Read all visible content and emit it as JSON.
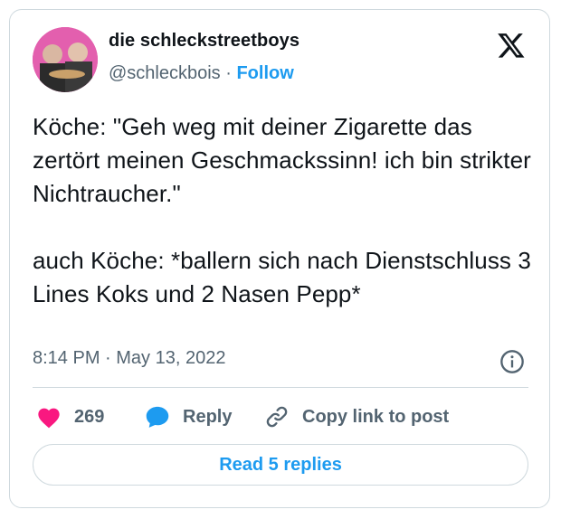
{
  "author": {
    "display_name": "die schleckstreetboys",
    "handle": "@schleckbois",
    "separator": " · ",
    "follow_label": "Follow"
  },
  "tweet": {
    "text": "Köche: \"Geh weg mit deiner Zigarette das zertört meinen Geschmackssinn! ich bin strikter Nichtraucher.\"\n\nauch Köche: *ballern sich nach Dienstschluss 3 Lines Koks und 2 Nasen Pepp*",
    "timestamp": "8:14 PM · May 13, 2022"
  },
  "actions": {
    "like_count": "269",
    "reply_label": "Reply",
    "copy_link_label": "Copy link to post"
  },
  "footer": {
    "read_replies_label": "Read 5 replies"
  },
  "colors": {
    "accent": "#1d9bf0",
    "like": "#f91880",
    "secondary_text": "#536471",
    "border": "#cfd9de"
  },
  "icons": [
    "x-logo-icon",
    "info-icon",
    "heart-icon",
    "reply-bubble-icon",
    "link-icon"
  ]
}
